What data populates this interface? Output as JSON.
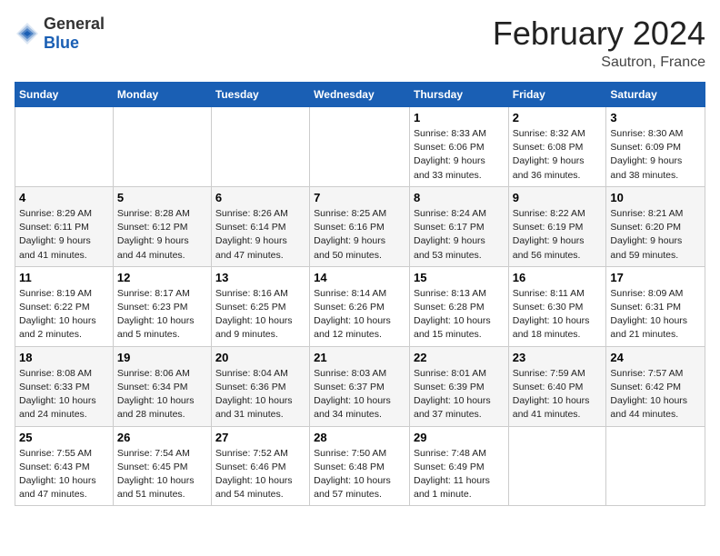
{
  "header": {
    "logo_general": "General",
    "logo_blue": "Blue",
    "month": "February 2024",
    "location": "Sautron, France"
  },
  "weekdays": [
    "Sunday",
    "Monday",
    "Tuesday",
    "Wednesday",
    "Thursday",
    "Friday",
    "Saturday"
  ],
  "rows": [
    [
      {
        "day": "",
        "info": ""
      },
      {
        "day": "",
        "info": ""
      },
      {
        "day": "",
        "info": ""
      },
      {
        "day": "",
        "info": ""
      },
      {
        "day": "1",
        "info": "Sunrise: 8:33 AM\nSunset: 6:06 PM\nDaylight: 9 hours\nand 33 minutes."
      },
      {
        "day": "2",
        "info": "Sunrise: 8:32 AM\nSunset: 6:08 PM\nDaylight: 9 hours\nand 36 minutes."
      },
      {
        "day": "3",
        "info": "Sunrise: 8:30 AM\nSunset: 6:09 PM\nDaylight: 9 hours\nand 38 minutes."
      }
    ],
    [
      {
        "day": "4",
        "info": "Sunrise: 8:29 AM\nSunset: 6:11 PM\nDaylight: 9 hours\nand 41 minutes."
      },
      {
        "day": "5",
        "info": "Sunrise: 8:28 AM\nSunset: 6:12 PM\nDaylight: 9 hours\nand 44 minutes."
      },
      {
        "day": "6",
        "info": "Sunrise: 8:26 AM\nSunset: 6:14 PM\nDaylight: 9 hours\nand 47 minutes."
      },
      {
        "day": "7",
        "info": "Sunrise: 8:25 AM\nSunset: 6:16 PM\nDaylight: 9 hours\nand 50 minutes."
      },
      {
        "day": "8",
        "info": "Sunrise: 8:24 AM\nSunset: 6:17 PM\nDaylight: 9 hours\nand 53 minutes."
      },
      {
        "day": "9",
        "info": "Sunrise: 8:22 AM\nSunset: 6:19 PM\nDaylight: 9 hours\nand 56 minutes."
      },
      {
        "day": "10",
        "info": "Sunrise: 8:21 AM\nSunset: 6:20 PM\nDaylight: 9 hours\nand 59 minutes."
      }
    ],
    [
      {
        "day": "11",
        "info": "Sunrise: 8:19 AM\nSunset: 6:22 PM\nDaylight: 10 hours\nand 2 minutes."
      },
      {
        "day": "12",
        "info": "Sunrise: 8:17 AM\nSunset: 6:23 PM\nDaylight: 10 hours\nand 5 minutes."
      },
      {
        "day": "13",
        "info": "Sunrise: 8:16 AM\nSunset: 6:25 PM\nDaylight: 10 hours\nand 9 minutes."
      },
      {
        "day": "14",
        "info": "Sunrise: 8:14 AM\nSunset: 6:26 PM\nDaylight: 10 hours\nand 12 minutes."
      },
      {
        "day": "15",
        "info": "Sunrise: 8:13 AM\nSunset: 6:28 PM\nDaylight: 10 hours\nand 15 minutes."
      },
      {
        "day": "16",
        "info": "Sunrise: 8:11 AM\nSunset: 6:30 PM\nDaylight: 10 hours\nand 18 minutes."
      },
      {
        "day": "17",
        "info": "Sunrise: 8:09 AM\nSunset: 6:31 PM\nDaylight: 10 hours\nand 21 minutes."
      }
    ],
    [
      {
        "day": "18",
        "info": "Sunrise: 8:08 AM\nSunset: 6:33 PM\nDaylight: 10 hours\nand 24 minutes."
      },
      {
        "day": "19",
        "info": "Sunrise: 8:06 AM\nSunset: 6:34 PM\nDaylight: 10 hours\nand 28 minutes."
      },
      {
        "day": "20",
        "info": "Sunrise: 8:04 AM\nSunset: 6:36 PM\nDaylight: 10 hours\nand 31 minutes."
      },
      {
        "day": "21",
        "info": "Sunrise: 8:03 AM\nSunset: 6:37 PM\nDaylight: 10 hours\nand 34 minutes."
      },
      {
        "day": "22",
        "info": "Sunrise: 8:01 AM\nSunset: 6:39 PM\nDaylight: 10 hours\nand 37 minutes."
      },
      {
        "day": "23",
        "info": "Sunrise: 7:59 AM\nSunset: 6:40 PM\nDaylight: 10 hours\nand 41 minutes."
      },
      {
        "day": "24",
        "info": "Sunrise: 7:57 AM\nSunset: 6:42 PM\nDaylight: 10 hours\nand 44 minutes."
      }
    ],
    [
      {
        "day": "25",
        "info": "Sunrise: 7:55 AM\nSunset: 6:43 PM\nDaylight: 10 hours\nand 47 minutes."
      },
      {
        "day": "26",
        "info": "Sunrise: 7:54 AM\nSunset: 6:45 PM\nDaylight: 10 hours\nand 51 minutes."
      },
      {
        "day": "27",
        "info": "Sunrise: 7:52 AM\nSunset: 6:46 PM\nDaylight: 10 hours\nand 54 minutes."
      },
      {
        "day": "28",
        "info": "Sunrise: 7:50 AM\nSunset: 6:48 PM\nDaylight: 10 hours\nand 57 minutes."
      },
      {
        "day": "29",
        "info": "Sunrise: 7:48 AM\nSunset: 6:49 PM\nDaylight: 11 hours\nand 1 minute."
      },
      {
        "day": "",
        "info": ""
      },
      {
        "day": "",
        "info": ""
      }
    ]
  ]
}
